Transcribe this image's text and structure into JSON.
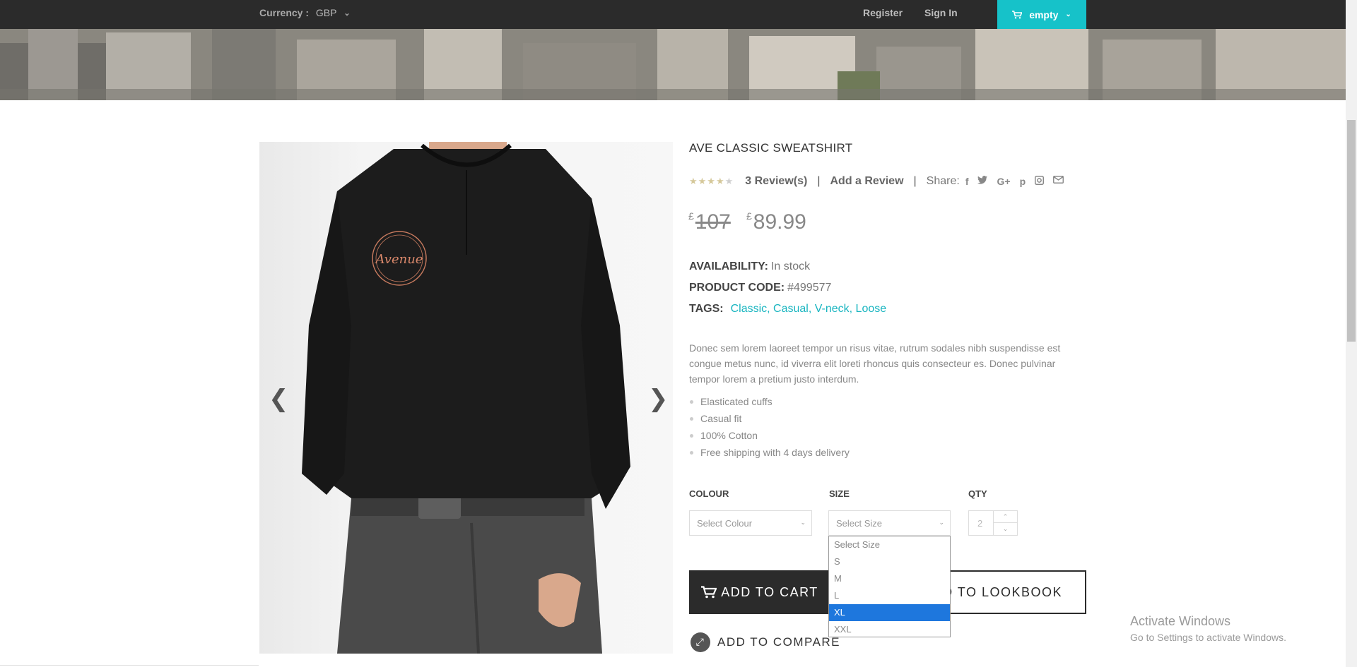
{
  "topbar": {
    "currency_label": "Currency :",
    "currency_value": "GBP",
    "register": "Register",
    "sign_in": "Sign In",
    "cart_label": "empty"
  },
  "product": {
    "title": "AVE CLASSIC SWEATSHIRT",
    "rating": 3.5,
    "rating_max": 5,
    "reviews": "3 Review(s)",
    "separator": "|",
    "add_review": "Add a Review",
    "share_label": "Share:",
    "share_icons": [
      "facebook-icon",
      "twitter-icon",
      "google-plus-icon",
      "pinterest-icon",
      "instagram-icon",
      "email-icon"
    ],
    "currency_symbol": "£",
    "old_price": "107",
    "new_price": "89.99",
    "availability_label": "AVAILABILITY:",
    "availability_value": "In stock",
    "code_label": "PRODUCT CODE:",
    "code_value": "#499577",
    "tags_label": "TAGS:",
    "tags_value": "Classic, Casual, V-neck, Loose",
    "description": "Donec sem lorem laoreet tempor un risus vitae, rutrum sodales nibh suspendisse est congue metus nunc, id viverra elit loreti rhoncus quis consecteur es. Donec pulvinar tempor lorem a pretium justo interdum.",
    "features": [
      "Elasticated cuffs",
      "Casual fit",
      "100% Cotton",
      "Free shipping with 4 days delivery"
    ]
  },
  "options": {
    "colour_label": "COLOUR",
    "colour_placeholder": "Select Colour",
    "size_label": "SIZE",
    "size_placeholder": "Select Size",
    "qty_label": "QTY",
    "qty_value": "2",
    "size_options": [
      "Select Size",
      "S",
      "M",
      "L",
      "XL",
      "XXL"
    ],
    "size_highlighted": "XL"
  },
  "actions": {
    "add_to_cart": "ADD TO CART",
    "add_to_lookbook": "D TO LOOKBOOK",
    "add_to_compare": "ADD TO COMPARE"
  },
  "shirt_logo": "Avenue",
  "watermark": {
    "line1": "Activate Windows",
    "line2": "Go to Settings to activate Windows."
  },
  "colors": {
    "accent": "#16c2c9",
    "dark": "#2b2b2b",
    "tag_link": "#19b5c0",
    "highlight": "#1e77dd"
  }
}
